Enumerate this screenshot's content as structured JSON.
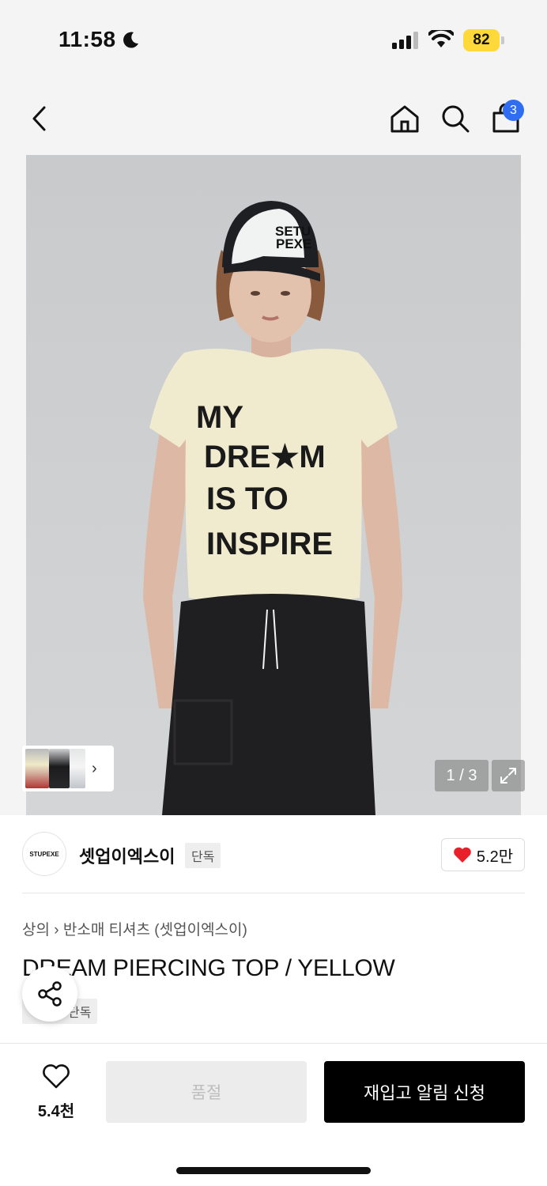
{
  "status_bar": {
    "time": "11:58",
    "battery": "82"
  },
  "nav": {
    "cart_count": "3",
    "icons": [
      "back-icon",
      "home-icon",
      "search-icon",
      "bag-icon"
    ]
  },
  "gallery": {
    "counter": "1 / 3",
    "photo_text": [
      "MY",
      "DRE★M",
      "IS TO",
      "INSPIRE"
    ],
    "cap_text": [
      "SETU",
      "PEXE"
    ]
  },
  "brand": {
    "logo_text": "STUPEXE",
    "name": "셋업이엑스이",
    "exclusive": "단독",
    "likes": "5.2만"
  },
  "product": {
    "breadcrumb": [
      "상의",
      "반소매 티셔츠 (셋업이엑스이)"
    ],
    "title": "DREAM PIERCING TOP / YELLOW",
    "tag": "단독"
  },
  "bottom": {
    "wish_count": "5.4천",
    "soldout_label": "품절",
    "restock_label": "재입고 알림 신청"
  },
  "colors": {
    "accent": "#2f6df3",
    "heart": "#e8202a",
    "battery": "#ffd83a"
  }
}
